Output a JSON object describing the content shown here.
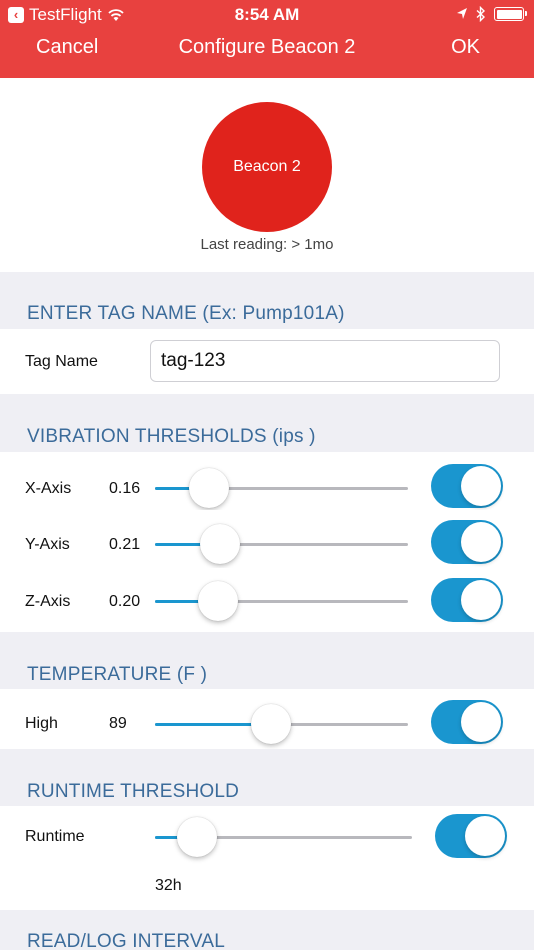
{
  "status_bar": {
    "back_app": "TestFlight",
    "time": "8:54 AM"
  },
  "nav": {
    "cancel": "Cancel",
    "title": "Configure Beacon 2",
    "ok": "OK"
  },
  "beacon": {
    "name": "Beacon 2",
    "last_reading": "Last reading: > 1mo"
  },
  "tag_section": {
    "header": "ENTER TAG NAME (Ex: Pump101A)",
    "label": "Tag Name",
    "value": "tag-123"
  },
  "vibration": {
    "header": "VIBRATION THRESHOLDS (ips )",
    "rows": [
      {
        "label": "X-Axis",
        "value": "0.16",
        "level": 0.16,
        "enabled": true
      },
      {
        "label": "Y-Axis",
        "value": "0.21",
        "level": 0.21,
        "enabled": true
      },
      {
        "label": "Z-Axis",
        "value": "0.20",
        "level": 0.2,
        "enabled": true
      }
    ]
  },
  "temperature": {
    "header": "TEMPERATURE (F )",
    "label": "High",
    "value": "89",
    "level": 0.45,
    "enabled": true
  },
  "runtime": {
    "header": "RUNTIME THRESHOLD",
    "label": "Runtime",
    "value": "32h",
    "level": 0.1,
    "enabled": true
  },
  "interval": {
    "header": "READ/LOG INTERVAL"
  },
  "colors": {
    "nav_bar": "#e8413f",
    "beacon": "#e0231c",
    "accent": "#1a96cf",
    "section_header_text": "#3b6b9a",
    "section_header_bg": "#efeff4"
  }
}
